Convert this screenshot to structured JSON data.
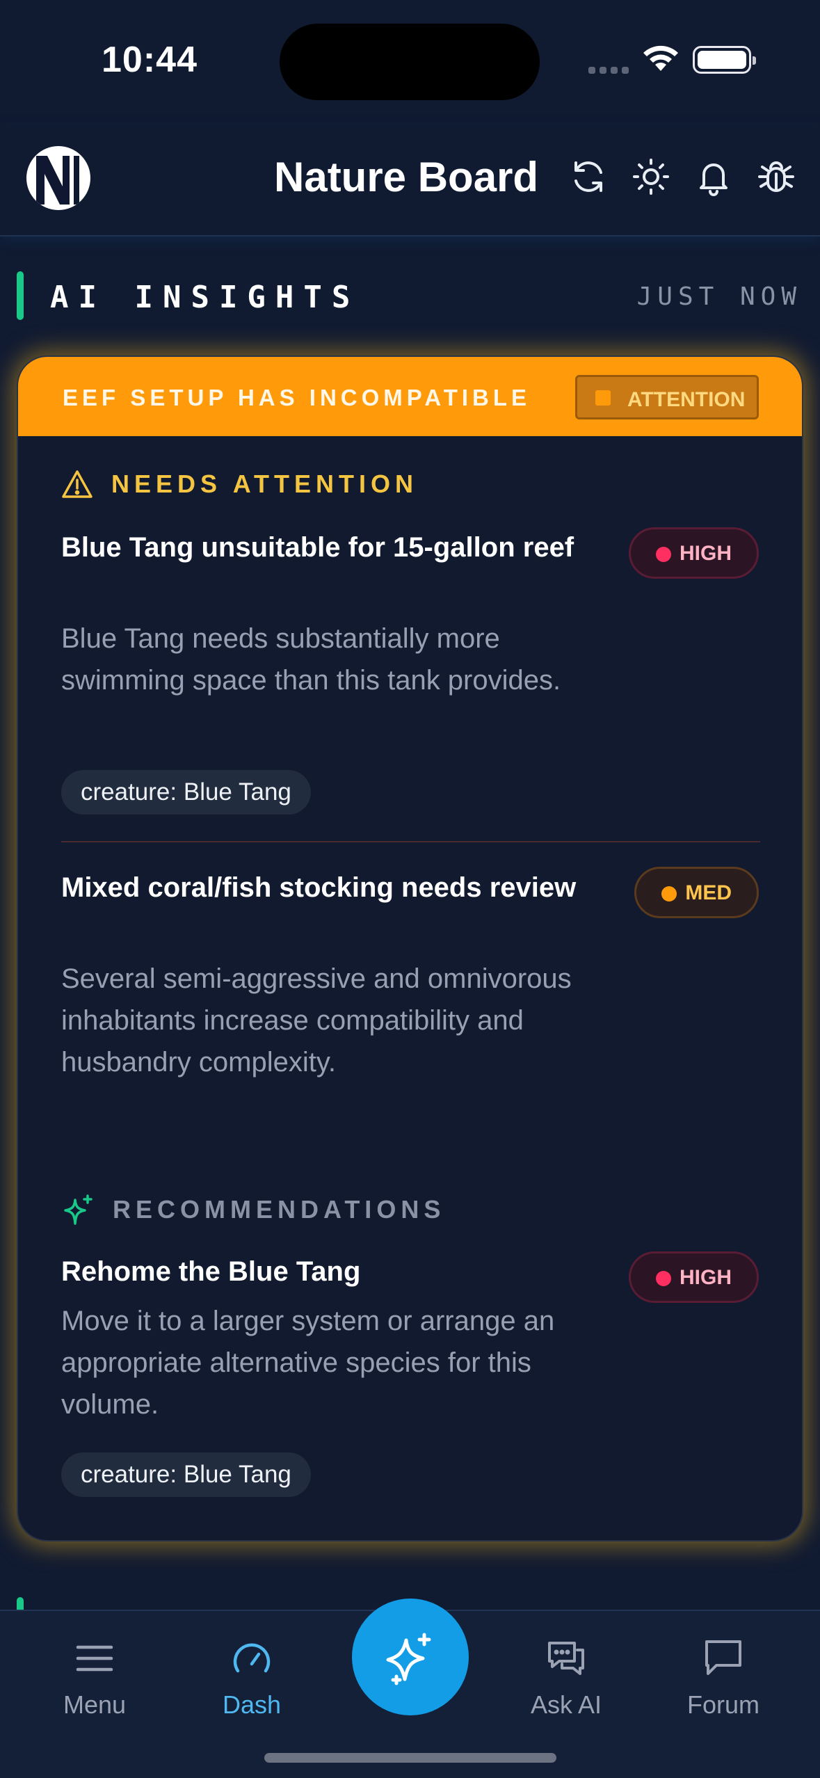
{
  "status_bar": {
    "time": "10:44"
  },
  "header": {
    "title": "Nature Board"
  },
  "insights": {
    "section_title": "AI INSIGHTS",
    "updated": "JUST NOW",
    "banner_text": "EEF SETUP HAS INCOMPATIBLE",
    "banner_badge": "ATTENTION",
    "attention_heading": "NEEDS ATTENTION",
    "recommendations_heading": "RECOMMENDATIONS",
    "attention_items": [
      {
        "title": "Blue Tang unsuitable for 15-gallon reef",
        "severity": "HIGH",
        "description": "Blue Tang needs substantially more swimming space than this tank provides.",
        "tag": "creature: Blue Tang"
      },
      {
        "title": "Mixed coral/fish stocking needs review",
        "severity": "MED",
        "description": "Several semi-aggressive and omnivorous inhabitants increase compatibility and husbandry complexity."
      }
    ],
    "recommendations": [
      {
        "title": "Rehome the Blue Tang",
        "severity": "HIGH",
        "description": "Move it to a larger system or arrange an appropriate alternative species for this volume.",
        "tag": "creature: Blue Tang"
      }
    ]
  },
  "tab_bar": {
    "active": "Dash",
    "items": [
      {
        "label": "Menu",
        "icon": "menu-icon"
      },
      {
        "label": "Dash",
        "icon": "gauge-icon"
      },
      {
        "label": "Ask AI",
        "icon": "chat-bubbles-icon"
      },
      {
        "label": "Forum",
        "icon": "speech-bubble-icon"
      }
    ],
    "center_button_icon": "sparkles-icon"
  },
  "colors": {
    "background": "#101a31",
    "accent_green": "#19c98a",
    "banner_orange": "#ff9b0a",
    "attention_yellow": "#f5c542",
    "severity_high": "#ff2f62",
    "severity_med": "#ff9b0a",
    "active_tab": "#4fb8f0",
    "fab_blue": "#129de6"
  }
}
